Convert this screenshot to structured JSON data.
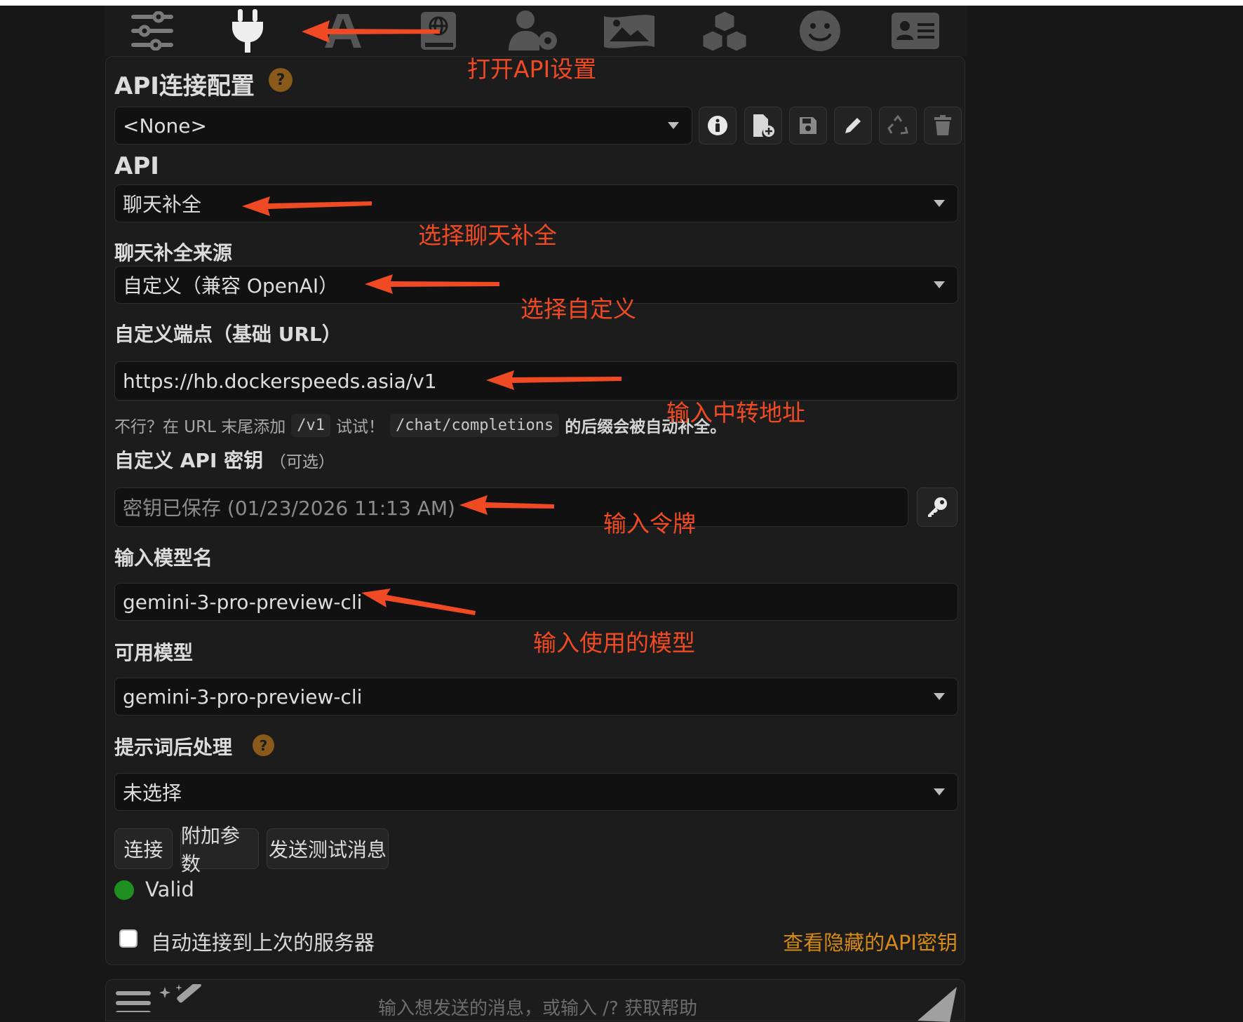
{
  "toolbar": {
    "icons": [
      "sliders-icon",
      "plug-icon",
      "font-icon",
      "book-globe-icon",
      "user-gear-icon",
      "image-icon",
      "cubes-icon",
      "smiley-icon",
      "contact-card-icon"
    ]
  },
  "connection": {
    "section_title": "API连接配置",
    "help_badge": "?",
    "profile_select_value": "<None>",
    "profile_buttons": [
      "info-icon",
      "new-file-icon",
      "save-icon",
      "pencil-icon",
      "recycle-icon",
      "trash-icon"
    ]
  },
  "api": {
    "label": "API",
    "select_value": "聊天补全"
  },
  "source": {
    "label": "聊天补全来源",
    "select_value": "自定义（兼容 OpenAI）"
  },
  "endpoint": {
    "label": "自定义端点（基础 URL）",
    "value": "https://hb.dockerspeeds.asia/v1",
    "hint_prefix": "不行？在 URL 末尾添加",
    "hint_code1": "/v1",
    "hint_mid": "试试！",
    "hint_code2": "/chat/completions",
    "hint_suffix": "的后缀会被自动补全。"
  },
  "api_key": {
    "label": "自定义 API 密钥",
    "optional": "（可选）",
    "placeholder": "密钥已保存 (01/23/2026 11:13 AM)"
  },
  "model_input": {
    "label": "输入模型名",
    "value": "gemini-3-pro-preview-cli"
  },
  "available_models": {
    "label": "可用模型",
    "select_value": "gemini-3-pro-preview-cli"
  },
  "postprocess": {
    "label": "提示词后处理",
    "help_badge": "?",
    "select_value": "未选择"
  },
  "buttons": {
    "connect": "连接",
    "extra_params": "附加参数",
    "send_test": "发送测试消息"
  },
  "status": {
    "text": "Valid",
    "color": "#1f8f1f"
  },
  "auto_connect": {
    "label": "自动连接到上次的服务器",
    "checked": false
  },
  "reveal_link": "查看隐藏的API密钥",
  "chat": {
    "placeholder": "输入想发送的消息，或输入 /? 获取帮助"
  },
  "annotations": {
    "open_api": "打开API设置",
    "choose_chat": "选择聊天补全",
    "choose_custom": "选择自定义",
    "enter_proxy": "输入中转地址",
    "enter_token": "输入令牌",
    "enter_model": "输入使用的模型",
    "color": "#f04a24"
  }
}
